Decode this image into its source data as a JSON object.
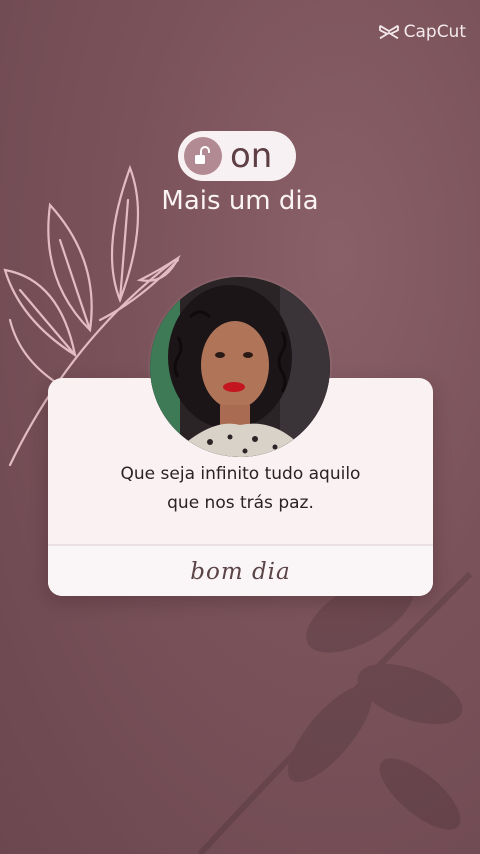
{
  "watermark": {
    "brand": "CapCut",
    "icon": "capcut-logo-icon"
  },
  "header": {
    "status_label": "on",
    "status_icon": "unlock-icon",
    "subtitle": "Mais um dia"
  },
  "card": {
    "quote_lines": [
      "Que seja infinito tudo aquilo",
      "que nos trás paz."
    ],
    "signature": "bom dia"
  },
  "colors": {
    "background": "#7a525a",
    "card": "#f9f1f2",
    "accent": "#b28a93",
    "leaf": "#e3bcc3"
  }
}
